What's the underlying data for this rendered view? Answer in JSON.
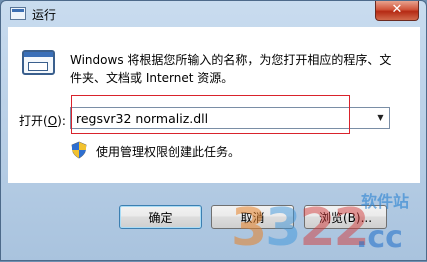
{
  "window": {
    "title": "运行",
    "close_glyph": "✕"
  },
  "content": {
    "description": "Windows 将根据您所输入的名称，为您打开相应的程序、文件夹、文档或 Internet 资源。",
    "open_label_prefix": "打开(",
    "open_label_key": "O",
    "open_label_suffix": "):",
    "command_value": "regsvr32 normaliz.dll",
    "admin_note": "使用管理权限创建此任务。"
  },
  "buttons": {
    "ok": "确定",
    "cancel": "取消",
    "browse": "浏览(B)..."
  },
  "watermark": {
    "digits": [
      "3",
      "3",
      "22"
    ],
    "site_label": "软件站",
    "domain": ".cc"
  },
  "colors": {
    "highlight": "#d9232c",
    "close_button": "#c43b22"
  }
}
